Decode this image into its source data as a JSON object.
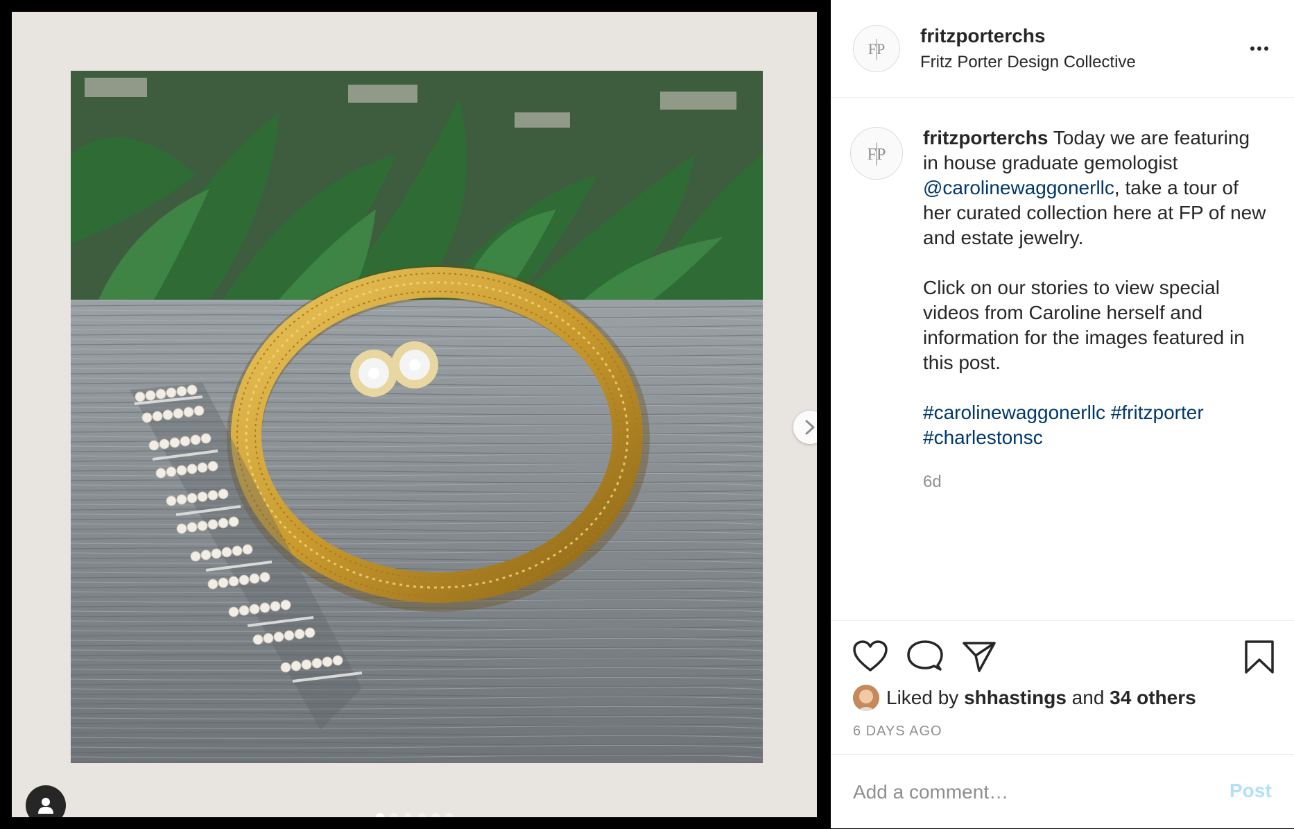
{
  "post": {
    "username": "fritzporterchs",
    "subtitle": "Fritz Porter Design Collective",
    "caption": {
      "username": "fritzporterchs",
      "text_1": " Today we are featuring in house graduate gemologist ",
      "mention": "@carolinewaggonerllc",
      "text_2": ", take a tour of her curated collection here at FP of new and estate jewelry.",
      "paragraph_2": "Click on our stories to view special videos from Caroline herself and information for the images featured in this post.",
      "hashtags": [
        "#carolinewaggonerllc",
        "#fritzporter",
        "#charlestonsc"
      ]
    },
    "caption_age": "6d",
    "likes": {
      "prefix": "Liked by ",
      "first_liker": "shhastings",
      "conjunction": " and ",
      "others": "34 others"
    },
    "date": "6 DAYS AGO"
  },
  "comment": {
    "placeholder": "Add a comment…",
    "post_label": "Post"
  },
  "carousel": {
    "total": 6,
    "active_index": 0
  },
  "icons": {
    "avatar": "fp-monogram-icon",
    "more": "more-options-icon",
    "like": "heart-icon",
    "comment": "comment-bubble-icon",
    "share": "paper-plane-icon",
    "save": "bookmark-icon",
    "next": "chevron-right-icon",
    "account": "person-icon"
  },
  "colors": {
    "link": "#00376b",
    "post_button_disabled": "#b2dffc",
    "muted_text": "#8e8e8e"
  }
}
